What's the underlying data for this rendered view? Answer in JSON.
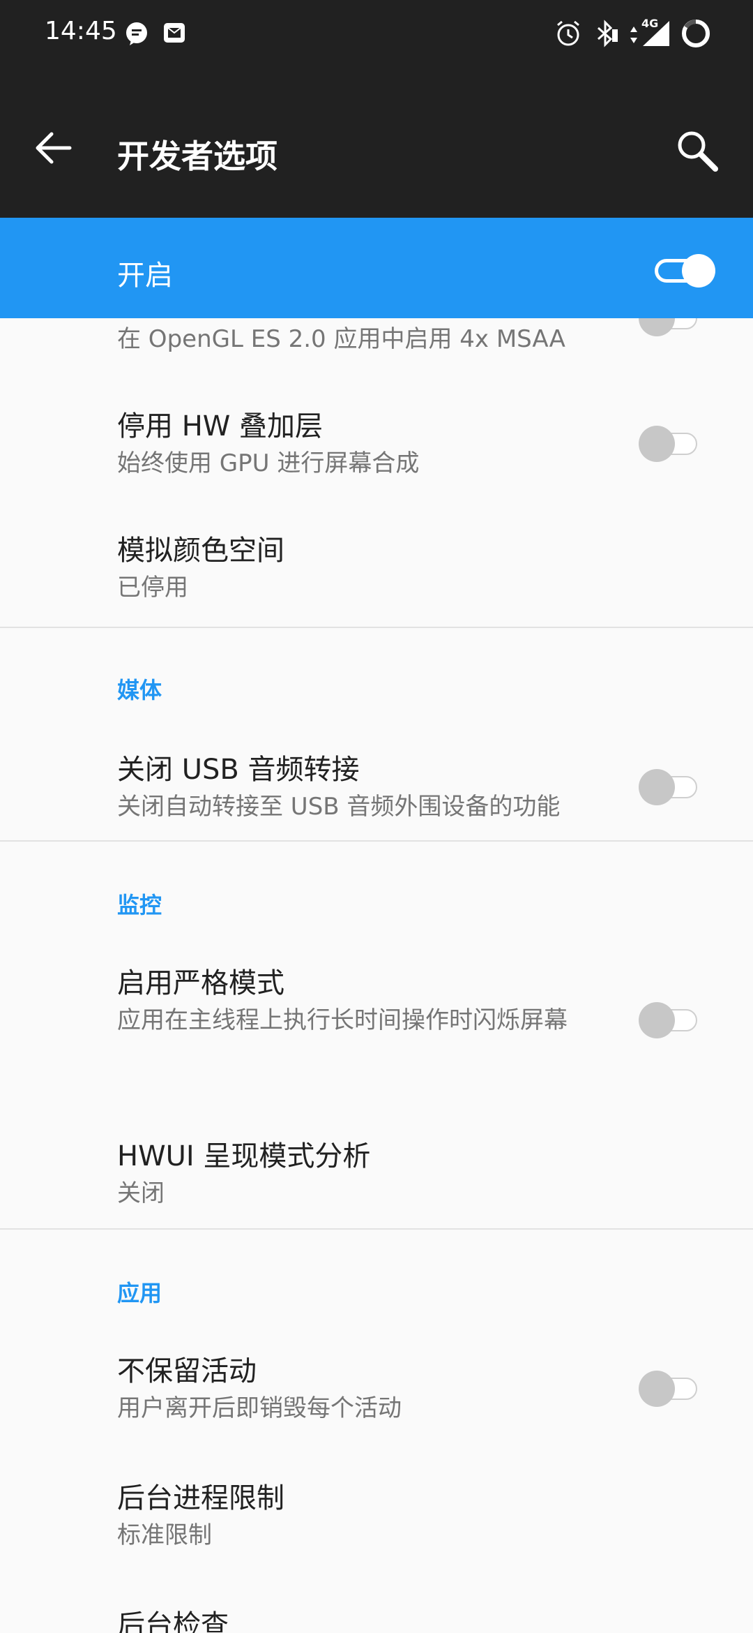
{
  "status_bar": {
    "time": "14:45",
    "left_icons": [
      "message-bubble-icon",
      "mail-icon"
    ],
    "right_icons": [
      "alarm-icon",
      "bluetooth-icon",
      "data-arrows-icon",
      "signal-4g-icon",
      "battery-ring-icon"
    ],
    "network_label": "4G"
  },
  "toolbar": {
    "title": "开发者选项",
    "back_icon": "arrow-left-icon",
    "search_icon": "search-icon"
  },
  "master_switch": {
    "label": "开启",
    "state": "on",
    "color": "#2196f3"
  },
  "items": [
    {
      "summary": "在 OpenGL ES 2.0 应用中启用 4x MSAA",
      "has_switch": true,
      "checked": false
    },
    {
      "title": "停用 HW 叠加层",
      "summary": "始终使用 GPU 进行屏幕合成",
      "has_switch": true,
      "checked": false
    },
    {
      "title": "模拟颜色空间",
      "summary": "已停用",
      "has_switch": false
    }
  ],
  "sections": [
    {
      "header": "媒体",
      "items": [
        {
          "title": "关闭 USB 音频转接",
          "summary": "关闭自动转接至 USB 音频外围设备的功能",
          "has_switch": true,
          "checked": false
        }
      ]
    },
    {
      "header": "监控",
      "items": [
        {
          "title": "启用严格模式",
          "summary": "应用在主线程上执行长时间操作时闪烁屏幕",
          "has_switch": true,
          "checked": false
        },
        {
          "title": "HWUI 呈现模式分析",
          "summary": "关闭",
          "has_switch": false
        }
      ]
    },
    {
      "header": "应用",
      "items": [
        {
          "title": "不保留活动",
          "summary": "用户离开后即销毁每个活动",
          "has_switch": true,
          "checked": false
        },
        {
          "title": "后台进程限制",
          "summary": "标准限制",
          "has_switch": false
        },
        {
          "title": "后台检查",
          "summary": "",
          "has_switch": false
        }
      ]
    }
  ]
}
